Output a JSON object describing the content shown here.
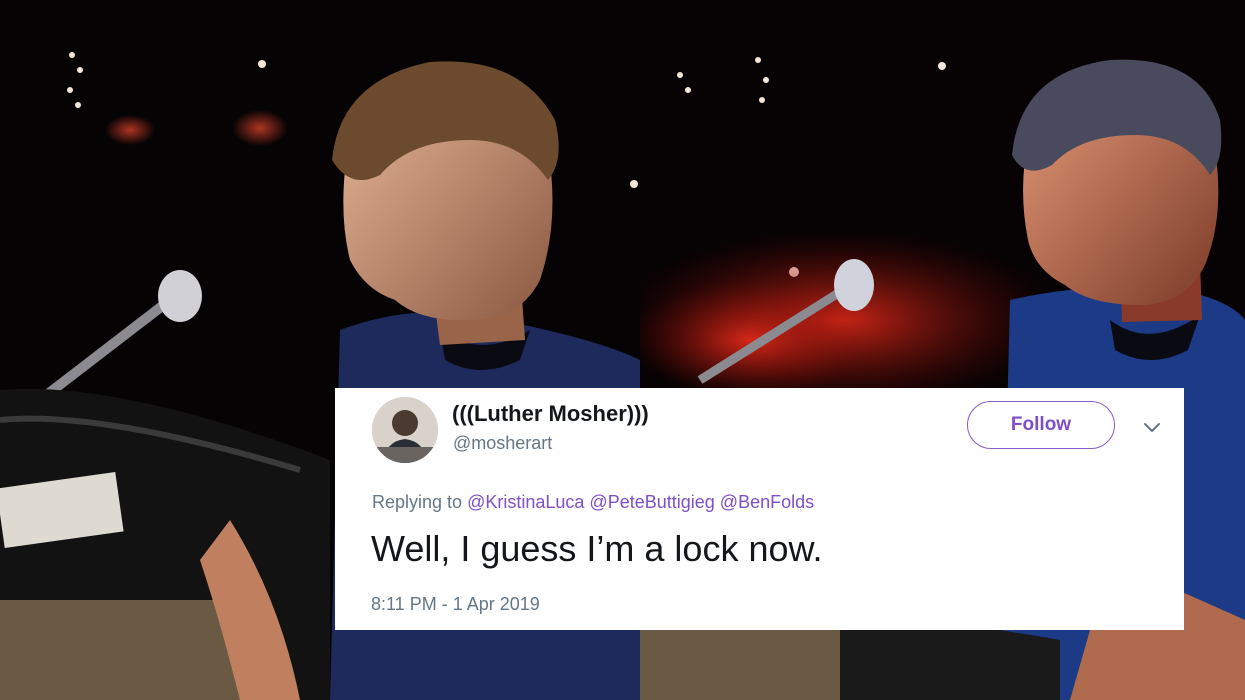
{
  "background": {
    "left_photo_icon": "man-at-microphone-photo",
    "right_photo_icon": "man-at-microphone-photo"
  },
  "tweet": {
    "display_name": "(((Luther Mosher)))",
    "handle": "@mosherart",
    "follow_label": "Follow",
    "menu_icon": "chevron-down-icon",
    "replying_prefix": "Replying to",
    "mentions": [
      "@KristinaLuca",
      "@PeteButtigieg",
      "@BenFolds"
    ],
    "text": "Well, I guess I’m a lock now.",
    "timestamp": "8:11 PM - 1 Apr 2019"
  },
  "colors": {
    "accent": "#7e4fc6",
    "muted": "#657786",
    "text": "#14171a"
  }
}
